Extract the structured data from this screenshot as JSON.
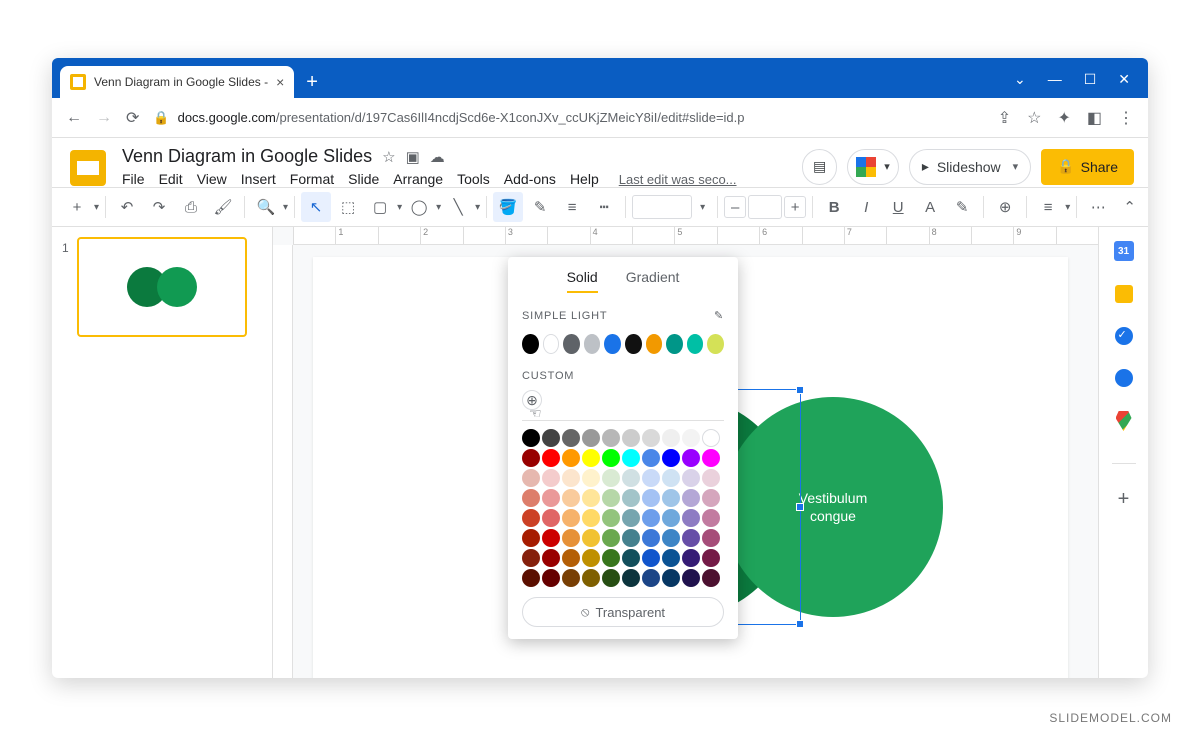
{
  "browser": {
    "tab_title": "Venn Diagram in Google Slides - ",
    "url_host": "docs.google.com",
    "url_path": "/presentation/d/197Cas6IlI4ncdjScd6e-X1conJXv_ccUKjZMeicY8iI/edit#slide=id.p"
  },
  "doc": {
    "title": "Venn Diagram in Google Slides",
    "menus": [
      "File",
      "Edit",
      "View",
      "Insert",
      "Format",
      "Slide",
      "Arrange",
      "Tools",
      "Add-ons",
      "Help"
    ],
    "last_edit": "Last edit was seco...",
    "slideshow_label": "Slideshow",
    "share_label": "Share"
  },
  "filmstrip": {
    "slide_number": "1"
  },
  "venn": {
    "right_text": "Vestibulum\ncongue"
  },
  "ruler": [
    "",
    "1",
    "",
    "2",
    "",
    "3",
    "",
    "4",
    "",
    "5",
    "",
    "6",
    "",
    "7",
    "",
    "8",
    "",
    "9",
    ""
  ],
  "sidepanel": {
    "cal_day": "31"
  },
  "picker": {
    "tab_solid": "Solid",
    "tab_gradient": "Gradient",
    "section_theme": "SIMPLE LIGHT",
    "section_custom": "CUSTOM",
    "transparent_label": "Transparent",
    "theme_colors": [
      "#000000",
      "#ffffff",
      "#5f6368",
      "#bdc1c6",
      "#1a73e8",
      "#111111",
      "#f29900",
      "#009688",
      "#00bfa5",
      "#d4e157"
    ],
    "grid_colors": [
      "#000000",
      "#434343",
      "#666666",
      "#999999",
      "#b7b7b7",
      "#cccccc",
      "#d9d9d9",
      "#efefef",
      "#f3f3f3",
      "#ffffff",
      "#980000",
      "#ff0000",
      "#ff9900",
      "#ffff00",
      "#00ff00",
      "#00ffff",
      "#4a86e8",
      "#0000ff",
      "#9900ff",
      "#ff00ff",
      "#e6b8af",
      "#f4cccc",
      "#fce5cd",
      "#fff2cc",
      "#d9ead3",
      "#d0e0e3",
      "#c9daf8",
      "#cfe2f3",
      "#d9d2e9",
      "#ead1dc",
      "#dd7e6b",
      "#ea9999",
      "#f9cb9c",
      "#ffe599",
      "#b6d7a8",
      "#a2c4c9",
      "#a4c2f4",
      "#9fc5e8",
      "#b4a7d6",
      "#d5a6bd",
      "#cc4125",
      "#e06666",
      "#f6b26b",
      "#ffd966",
      "#93c47d",
      "#76a5af",
      "#6d9eeb",
      "#6fa8dc",
      "#8e7cc3",
      "#c27ba0",
      "#a61c00",
      "#cc0000",
      "#e69138",
      "#f1c232",
      "#6aa84f",
      "#45818e",
      "#3c78d8",
      "#3d85c6",
      "#674ea7",
      "#a64d79",
      "#85200c",
      "#990000",
      "#b45f06",
      "#bf9000",
      "#38761d",
      "#134f5c",
      "#1155cc",
      "#0b5394",
      "#351c75",
      "#741b47",
      "#5b0f00",
      "#660000",
      "#783f04",
      "#7f6000",
      "#274e13",
      "#0c343d",
      "#1c4587",
      "#073763",
      "#20124d",
      "#4c1130"
    ]
  },
  "watermark": "SLIDEMODEL.COM"
}
